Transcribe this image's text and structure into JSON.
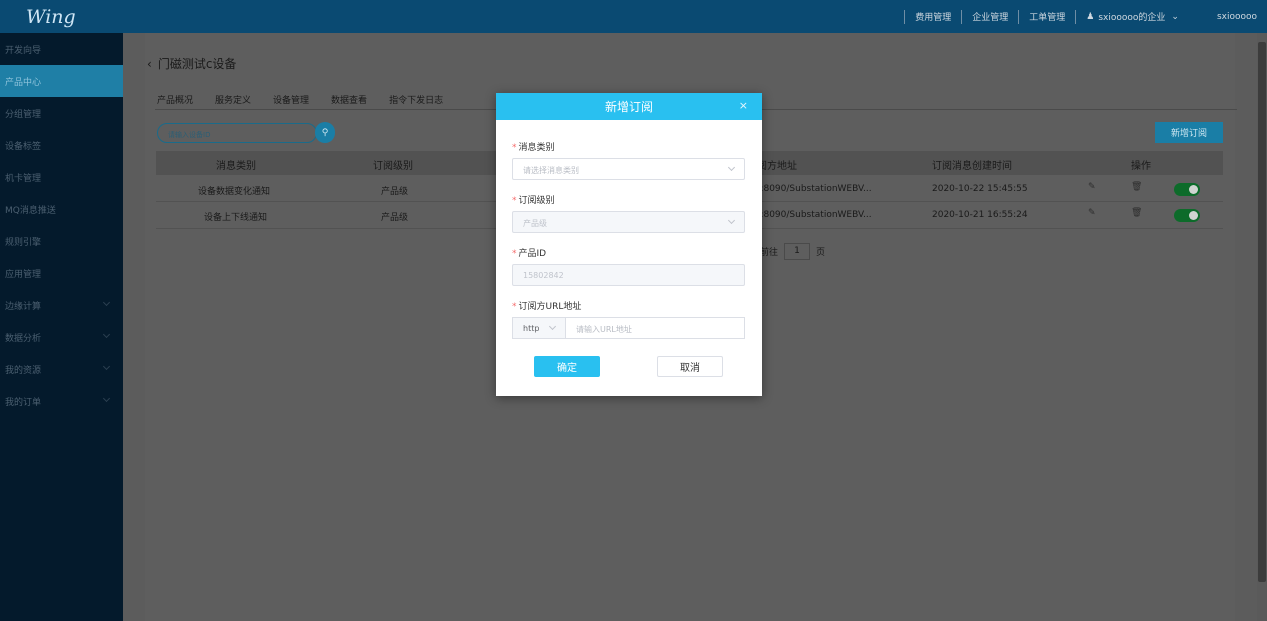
{
  "app": {
    "logo": "Wing"
  },
  "topnav": {
    "items": [
      "费用管理",
      "企业管理",
      "工单管理"
    ],
    "user": "sxiooooo的企业",
    "account": "sxiooooo"
  },
  "sidebar": {
    "items": [
      {
        "label": "开发向导"
      },
      {
        "label": "产品中心"
      },
      {
        "label": "分组管理"
      },
      {
        "label": "设备标签"
      },
      {
        "label": "机卡管理"
      },
      {
        "label": "MQ消息推送"
      },
      {
        "label": "规则引擎"
      },
      {
        "label": "应用管理"
      },
      {
        "label": "边缘计算"
      },
      {
        "label": "数据分析"
      },
      {
        "label": "我的资源"
      },
      {
        "label": "我的订单"
      }
    ]
  },
  "page": {
    "title": "门磁测试c设备",
    "tabs": [
      "产品概况",
      "服务定义",
      "设备管理",
      "数据查看",
      "指令下发日志"
    ],
    "search_placeholder": "请输入设备ID",
    "add_button": "新增订阅"
  },
  "table": {
    "headers": [
      "消息类别",
      "订阅级别",
      "阅方地址",
      "订阅消息创建时间",
      "操作"
    ],
    "rows": [
      {
        "category": "设备数据变化通知",
        "level": "产品级",
        "url": "55:8090/SubstationWEBV...",
        "time": "2020-10-22 15:45:55"
      },
      {
        "category": "设备上下线通知",
        "level": "产品级",
        "url": "55:8090/SubstationWEBV...",
        "time": "2020-10-21 16:55:24"
      }
    ]
  },
  "pager": {
    "prefix": "前往",
    "page": "1",
    "suffix": "页"
  },
  "modal": {
    "title": "新增订阅",
    "close": "×",
    "fields": {
      "category_label": "消息类别",
      "category_placeholder": "请选择消息类别",
      "level_label": "订阅级别",
      "level_value": "产品级",
      "product_label": "产品ID",
      "product_value": "15802842",
      "url_label": "订阅方URL地址",
      "url_protocol": "http",
      "url_placeholder": "请输入URL地址"
    },
    "ok": "确定",
    "cancel": "取消"
  },
  "colors": {
    "accent": "#29c0f0",
    "header": "#0a4a72",
    "sidebar": "#041a2c"
  }
}
